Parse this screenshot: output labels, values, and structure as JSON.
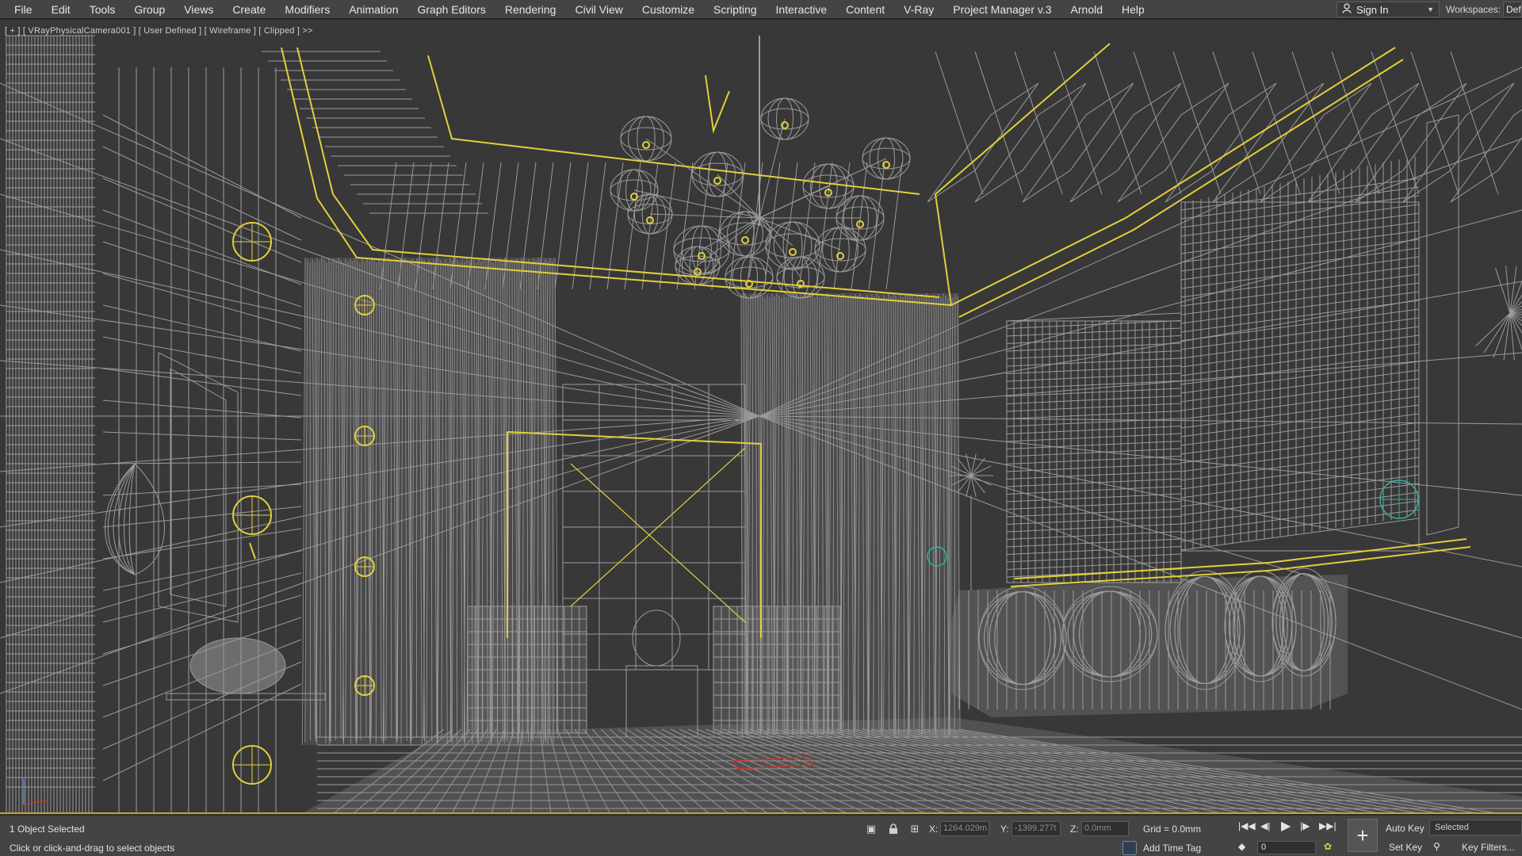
{
  "menubar": {
    "items": [
      "File",
      "Edit",
      "Tools",
      "Group",
      "Views",
      "Create",
      "Modifiers",
      "Animation",
      "Graph Editors",
      "Rendering",
      "Civil View",
      "Customize",
      "Scripting",
      "Interactive",
      "Content",
      "V-Ray",
      "Project Manager v.3",
      "Arnold",
      "Help"
    ],
    "sign_in": "Sign In",
    "workspaces_label": "Workspaces:",
    "workspaces_value": "Def"
  },
  "viewport": {
    "label": "[ + ] [ VRayPhysicalCamera001 ] [ User Defined ] [ Wireframe ] [ Clipped ] >>"
  },
  "status": {
    "selected": "1 Object Selected",
    "prompt": "Click or click-and-drag to select objects",
    "x_label": "X:",
    "x_value": "1264.029m",
    "y_label": "Y:",
    "y_value": "-1399.277t",
    "z_label": "Z:",
    "z_value": "0.0mm",
    "grid": "Grid = 0.0mm",
    "add_time_tag": "Add Time Tag",
    "frame": "0",
    "auto_key": "Auto Key",
    "set_key": "Set Key",
    "key_mode": "Selected",
    "key_filters": "Key Filters..."
  },
  "icons": {
    "key_mode_button": "+",
    "signin": "user-icon"
  },
  "colors": {
    "viewport_bg": "#393939",
    "wire": "#a8a8a8",
    "selected_wire": "#e0cc3a",
    "helper": "#2fb5a0"
  }
}
